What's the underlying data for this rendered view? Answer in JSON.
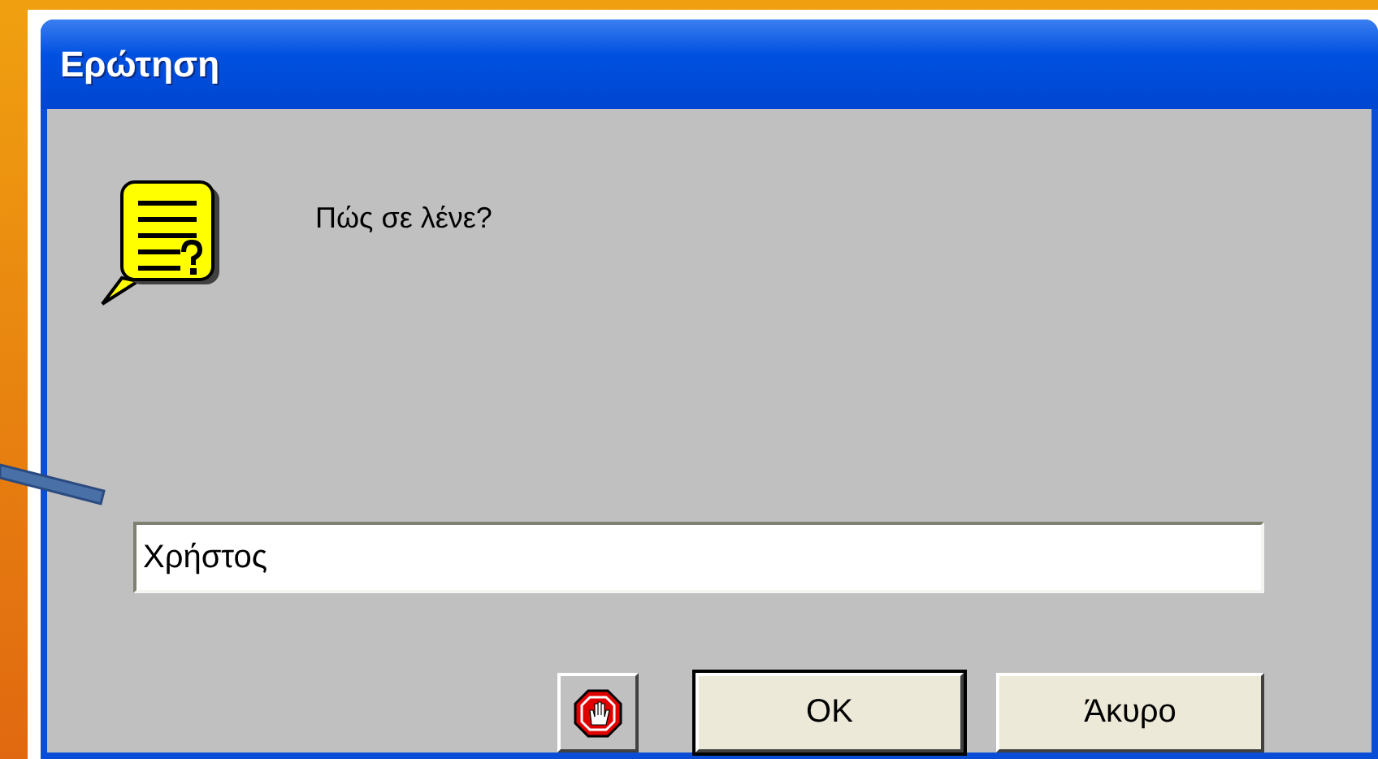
{
  "window": {
    "title": "Ερώτηση"
  },
  "prompt": "Πώς σε λένε?",
  "input": {
    "value": "Χρήστος"
  },
  "buttons": [
    {
      "kind": "icon",
      "default": false
    },
    {
      "kind": "text",
      "label": "OK",
      "default": true
    },
    {
      "kind": "text",
      "label": "Άκυρο",
      "default": false
    }
  ]
}
